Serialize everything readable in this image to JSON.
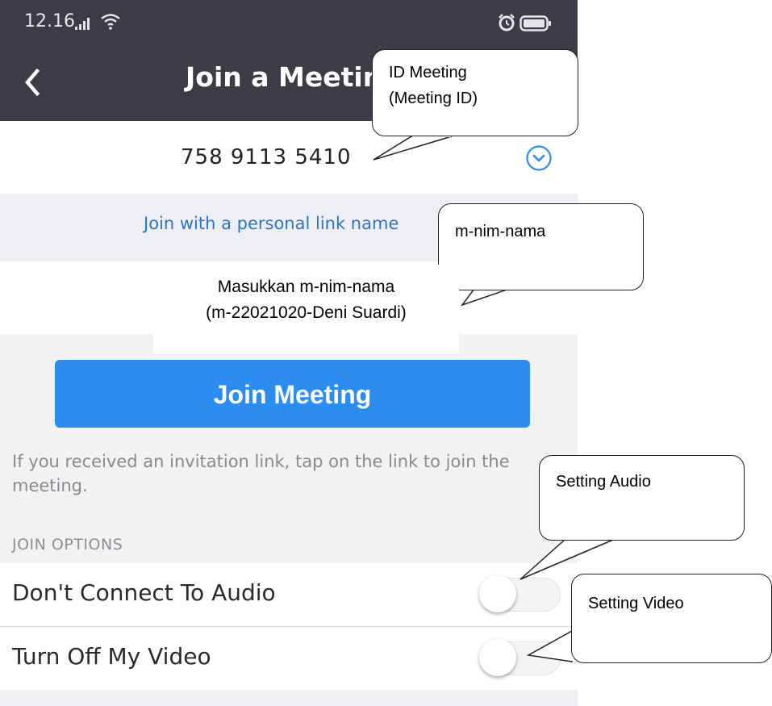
{
  "status_bar": {
    "time": "12.16"
  },
  "header": {
    "title": "Join a Meeting"
  },
  "meeting_id": {
    "value": "758 9113 5410"
  },
  "personal_link": {
    "label": "Join with a personal link name"
  },
  "join_button": {
    "label": "Join Meeting"
  },
  "hint": {
    "text": "If you received an invitation link, tap on the link to join the meeting."
  },
  "join_options": {
    "section_label": "JOIN OPTIONS",
    "items": [
      {
        "label": "Don't Connect To Audio",
        "on": false
      },
      {
        "label": "Turn Off My Video",
        "on": false
      }
    ]
  },
  "annotations": {
    "meeting_id": [
      "ID Meeting",
      "(Meeting ID)"
    ],
    "personal_link": [
      "m-nim-nama"
    ],
    "name_input": [
      "Masukkan m-nim-nama",
      "(m-22021020-Deni Suardi)"
    ],
    "audio": [
      "Setting Audio"
    ],
    "video": [
      "Setting Video"
    ]
  },
  "colors": {
    "header_bg": "#3c3c46",
    "accent_blue": "#2d8cf0",
    "link_blue": "#2d74c8",
    "page_gray": "#f2f2f4"
  },
  "icons": {
    "back": "back-chevron-icon",
    "dropdown": "chevron-down-circle-icon",
    "signal": "signal-icon",
    "wifi": "wifi-icon",
    "alarm": "alarm-icon",
    "battery": "battery-icon"
  }
}
